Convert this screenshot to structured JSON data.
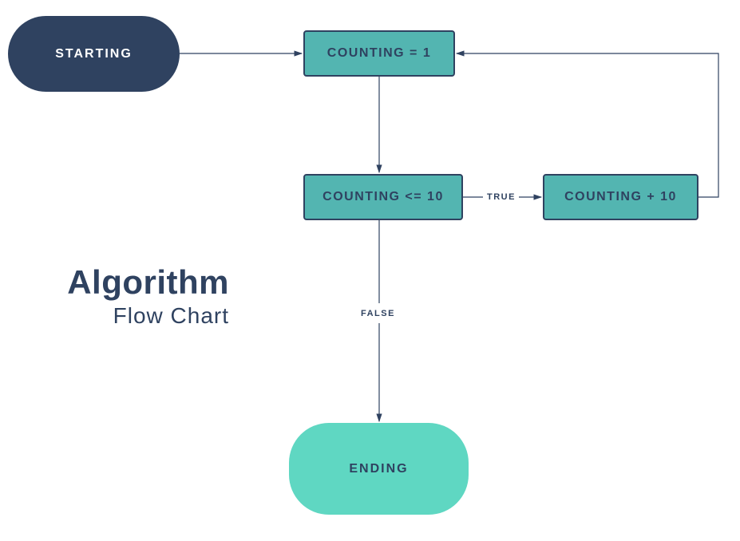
{
  "title": {
    "main": "Algorithm",
    "sub": "Flow Chart"
  },
  "nodes": {
    "start": "STARTING",
    "counting_init": "COUNTING = 1",
    "counting_cond": "COUNTING <= 10",
    "counting_inc": "COUNTING + 10",
    "end": "ENDING"
  },
  "edges": {
    "true_label": "TRUE",
    "false_label": "FALSE"
  },
  "colors": {
    "dark_navy": "#2f4260",
    "teal_fill": "#53b5b1",
    "mint": "#5fd7c2"
  }
}
